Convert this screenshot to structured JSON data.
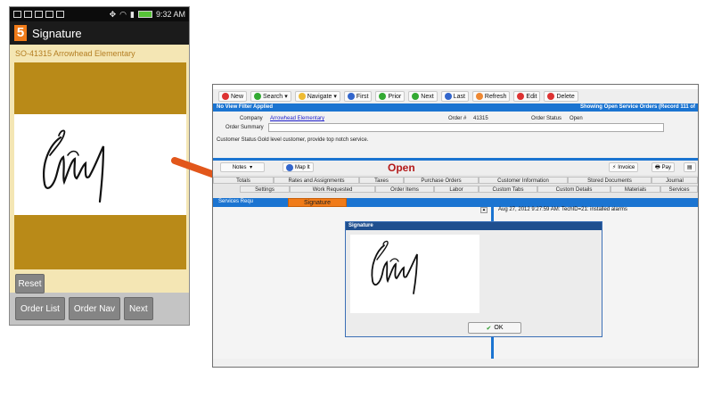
{
  "phone": {
    "status_time": "9:32 AM",
    "app_logo": "5",
    "title": "Signature",
    "header": "SO-41315 Arrowhead Elementary",
    "reset_label": "Reset",
    "nav_buttons": [
      "Order List",
      "Order Nav",
      "Next"
    ],
    "colors": {
      "accent": "#b98a18",
      "logo": "#f07b19",
      "background": "#f4e6b4"
    }
  },
  "desktop": {
    "toolbar": [
      "New",
      "Search",
      "Navigate",
      "First",
      "Prior",
      "Next",
      "Last",
      "Refresh",
      "Edit",
      "Delete"
    ],
    "info_bar_left": "No View Filter Applied",
    "info_bar_right": "Showing Open Service Orders",
    "info_bar_record": "(Record 111 of",
    "company_label": "Company",
    "company_value": "Arrowhead Elementary",
    "order_label": "Order #",
    "order_value": "41315",
    "status_label": "Order Status",
    "status_value": "Open",
    "summary_label": "Order Summary",
    "customer_status_label": "Customer Status",
    "customer_status_value": "Gold level customer, provide top notch service.",
    "notes_label": "Notes",
    "map_label": "Map It",
    "open_label": "Open",
    "invoice_label": "Invoice",
    "pay_label": "Pay",
    "tabs_row1": [
      "Totals",
      "Rates and Assignments",
      "Taxes",
      "Purchase Orders",
      "Customer Information",
      "Stored Documents",
      "Journal"
    ],
    "tabs_row2": [
      "Settings",
      "Work Requested",
      "Order Items",
      "Labor",
      "Custom Tabs",
      "Custom Details",
      "Materials",
      "Services"
    ],
    "services_label": "Services Requ",
    "signature_tab": "Signature",
    "log_entry": "Aug 27, 2012 9:27:59 AM: TechID=21: installed alarms",
    "dialog_title": "Signature",
    "ok_label": "OK",
    "colors": {
      "blue": "#1b74d1",
      "orange": "#f07b19",
      "open_red": "#b41a1a"
    }
  }
}
